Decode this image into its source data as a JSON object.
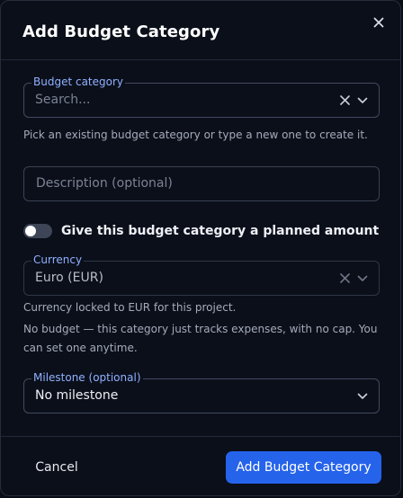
{
  "dialog": {
    "title": "Add Budget Category",
    "close_icon": "close-icon"
  },
  "budget_category": {
    "label": "Budget category",
    "placeholder": "Search...",
    "helper": "Pick an existing budget category or type a new one to create it.",
    "clear_icon": "clear-icon",
    "chevron_icon": "chevron-down-icon"
  },
  "description": {
    "placeholder": "Description (optional)"
  },
  "planned_amount": {
    "label": "Give this budget category a planned amount",
    "enabled": false
  },
  "currency": {
    "label": "Currency",
    "value": "Euro (EUR)",
    "helper_locked": "Currency locked to EUR for this project.",
    "helper_no_budget": "No budget — this category just tracks expenses, with no cap. You can set one anytime."
  },
  "milestone": {
    "label": "Milestone (optional)",
    "value": "No milestone"
  },
  "footer": {
    "cancel_label": "Cancel",
    "submit_label": "Add Budget Category"
  },
  "colors": {
    "accent": "#2563eb",
    "label_accent": "#8fb1ff",
    "background": "#0b0f1a",
    "border": "#3a4254"
  }
}
